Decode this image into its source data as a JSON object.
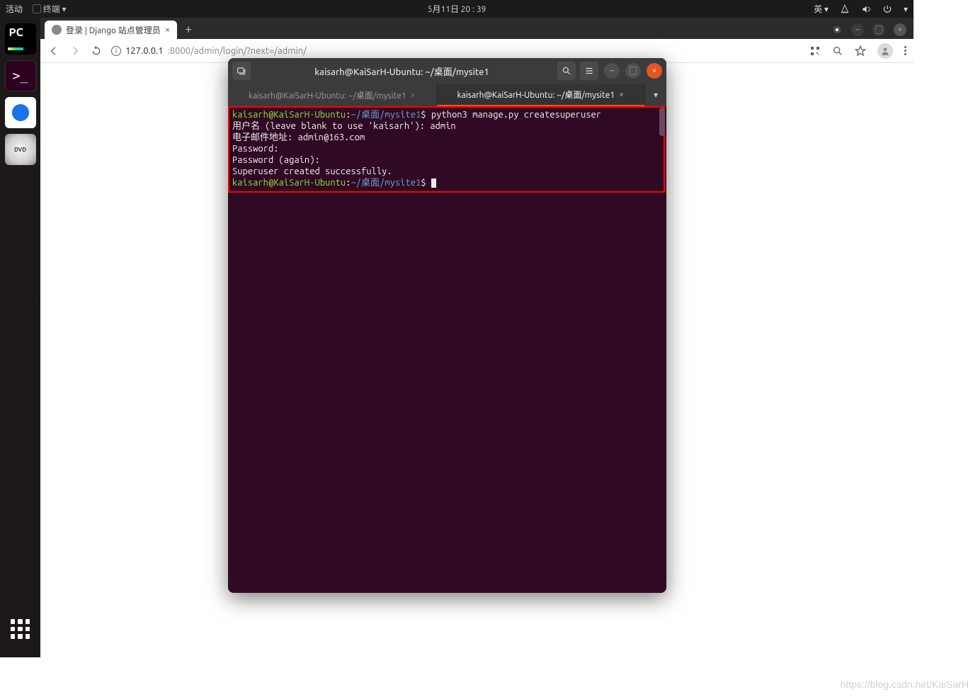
{
  "top_panel": {
    "activities": "活动",
    "app_name": "终端",
    "datetime": "5月11日 20 : 39",
    "ime": "英"
  },
  "browser": {
    "tab_title": "登录 | Django 站点管理员",
    "url_host": "127.0.0.1",
    "url_path": ":8000/admin/login/?next=/admin/"
  },
  "terminal": {
    "window_title": "kaisarh@KaiSarH-Ubuntu: ~/桌面/mysite1",
    "tabs": [
      {
        "label": "kaisarh@KaiSarH-Ubuntu: ~/桌面/mysite1",
        "active": false
      },
      {
        "label": "kaisarh@KaiSarH-Ubuntu: ~/桌面/mysite1",
        "active": true
      }
    ],
    "prompt_user": "kaisarh@KaiSarH-Ubuntu",
    "prompt_sep": ":",
    "prompt_path": "~/桌面/mysite1",
    "prompt_char": "$",
    "cmd": "python3 manage.py createsuperuser",
    "lines": {
      "l1": "用户名 (leave blank to use 'kaisarh'): admin",
      "l2": "电子邮件地址: admin@163.com",
      "l3": "Password:",
      "l4": "Password (again):",
      "l5": "Superuser created successfully."
    }
  },
  "watermark": "https://blog.csdn.net/KaiSarH"
}
